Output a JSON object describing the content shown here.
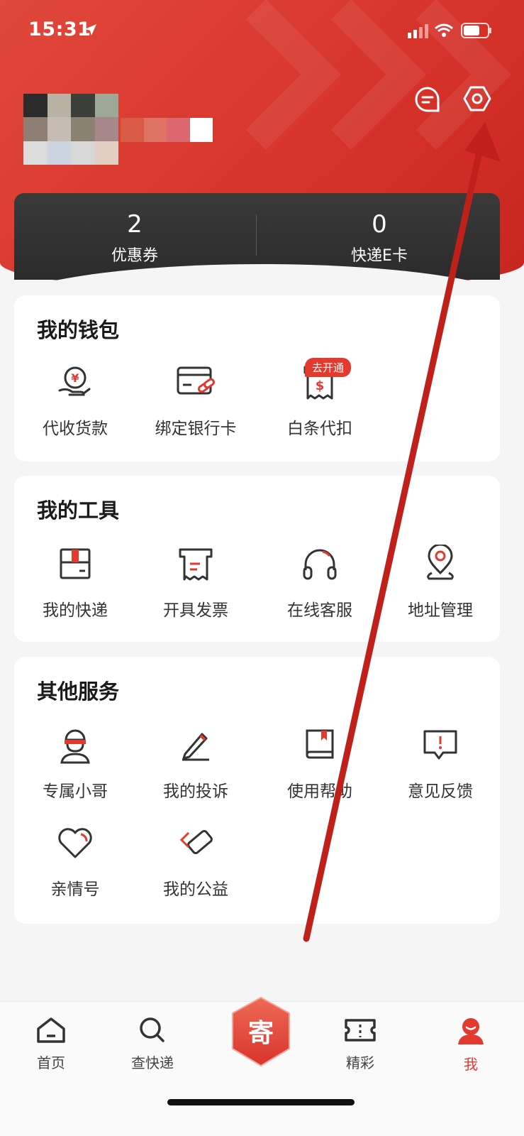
{
  "status_bar": {
    "time": "15:31"
  },
  "header": {
    "stats": [
      {
        "value": "2",
        "label": "优惠券"
      },
      {
        "value": "0",
        "label": "快递E卡"
      }
    ]
  },
  "wallet": {
    "title": "我的钱包",
    "items": [
      {
        "label": "代收货款",
        "icon": "yen-hand-icon"
      },
      {
        "label": "绑定银行卡",
        "icon": "bank-card-link-icon"
      },
      {
        "label": "白条代扣",
        "icon": "receipt-dollar-icon",
        "badge": "去开通"
      }
    ]
  },
  "tools": {
    "title": "我的工具",
    "items": [
      {
        "label": "我的快递",
        "icon": "package-icon"
      },
      {
        "label": "开具发票",
        "icon": "invoice-icon"
      },
      {
        "label": "在线客服",
        "icon": "headset-icon"
      },
      {
        "label": "地址管理",
        "icon": "location-pin-icon"
      }
    ]
  },
  "other": {
    "title": "其他服务",
    "items": [
      {
        "label": "专属小哥",
        "icon": "courier-icon"
      },
      {
        "label": "我的投诉",
        "icon": "pen-icon"
      },
      {
        "label": "使用帮助",
        "icon": "book-icon"
      },
      {
        "label": "意见反馈",
        "icon": "feedback-icon"
      },
      {
        "label": "亲情号",
        "icon": "heart-icon"
      },
      {
        "label": "我的公益",
        "icon": "charity-icon"
      }
    ]
  },
  "bottom_nav": {
    "items": [
      {
        "label": "首页",
        "icon": "home-icon"
      },
      {
        "label": "查快递",
        "icon": "search-icon"
      },
      {
        "label": "寄",
        "icon": "send-center-icon"
      },
      {
        "label": "精彩",
        "icon": "ticket-icon"
      },
      {
        "label": "我",
        "icon": "profile-icon",
        "active": true
      }
    ]
  },
  "colors": {
    "brand_red": "#e23a2e",
    "card_dark": "#2f2f2f",
    "annotation_arrow": "#c0201a"
  }
}
